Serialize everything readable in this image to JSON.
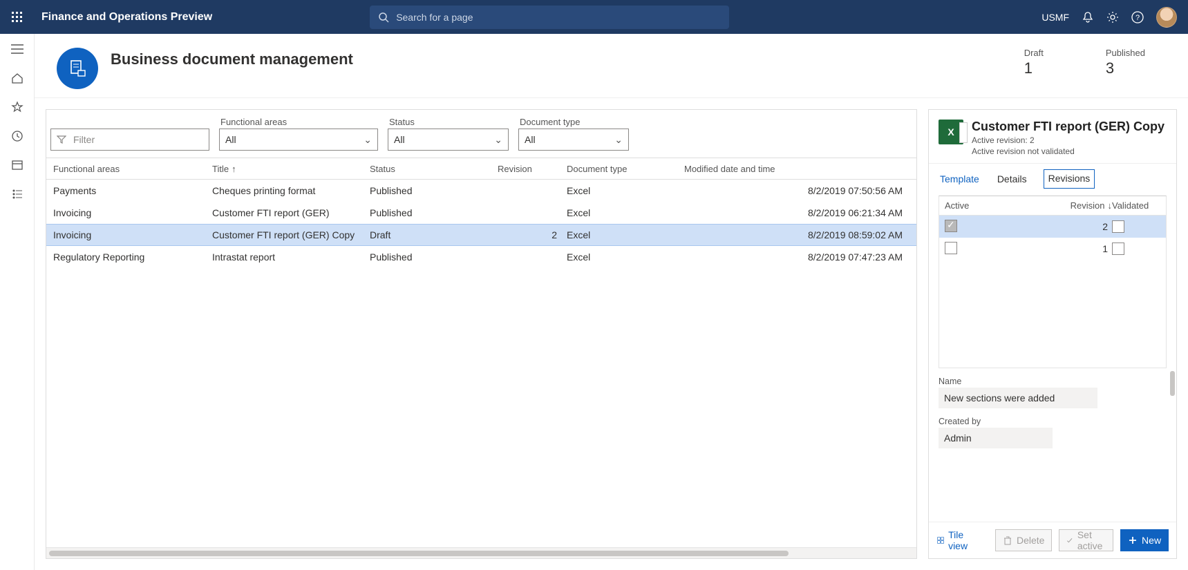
{
  "topbar": {
    "app_title": "Finance and Operations Preview",
    "search_placeholder": "Search for a page",
    "company": "USMF"
  },
  "header": {
    "title": "Business document management",
    "stats": {
      "draft_label": "Draft",
      "draft_value": "1",
      "published_label": "Published",
      "published_value": "3"
    }
  },
  "filters": {
    "filter_placeholder": "Filter",
    "functional_areas_label": "Functional areas",
    "functional_areas_value": "All",
    "status_label": "Status",
    "status_value": "All",
    "document_type_label": "Document type",
    "document_type_value": "All"
  },
  "columns": {
    "functional_areas": "Functional areas",
    "title": "Title",
    "status": "Status",
    "revision": "Revision",
    "document_type": "Document type",
    "modified": "Modified date and time"
  },
  "rows": [
    {
      "functional_area": "Payments",
      "title": "Cheques printing format",
      "status": "Published",
      "revision": "",
      "doc_type": "Excel",
      "modified": "8/2/2019 07:50:56 AM",
      "selected": false
    },
    {
      "functional_area": "Invoicing",
      "title": "Customer FTI report (GER)",
      "status": "Published",
      "revision": "",
      "doc_type": "Excel",
      "modified": "8/2/2019 06:21:34 AM",
      "selected": false
    },
    {
      "functional_area": "Invoicing",
      "title": "Customer FTI report (GER) Copy",
      "status": "Draft",
      "revision": "2",
      "doc_type": "Excel",
      "modified": "8/2/2019 08:59:02 AM",
      "selected": true
    },
    {
      "functional_area": "Regulatory Reporting",
      "title": "Intrastat report",
      "status": "Published",
      "revision": "",
      "doc_type": "Excel",
      "modified": "8/2/2019 07:47:23 AM",
      "selected": false
    }
  ],
  "side": {
    "title": "Customer FTI report (GER) Copy",
    "active_revision_line": "Active revision: 2",
    "validated_line": "Active revision not validated",
    "tabs": {
      "template": "Template",
      "details": "Details",
      "revisions": "Revisions"
    },
    "rev_columns": {
      "active": "Active",
      "revision": "Revision",
      "validated": "Validated"
    },
    "rev_rows": [
      {
        "active_checked": true,
        "revision": "2",
        "validated_checked": false,
        "selected": true
      },
      {
        "active_checked": false,
        "revision": "1",
        "validated_checked": false,
        "selected": false
      }
    ],
    "form": {
      "name_label": "Name",
      "name_value": "New sections were added",
      "created_by_label": "Created by",
      "created_by_value": "Admin"
    },
    "actions": {
      "tile_view": "Tile view",
      "delete": "Delete",
      "set_active": "Set active",
      "new": "New"
    }
  }
}
